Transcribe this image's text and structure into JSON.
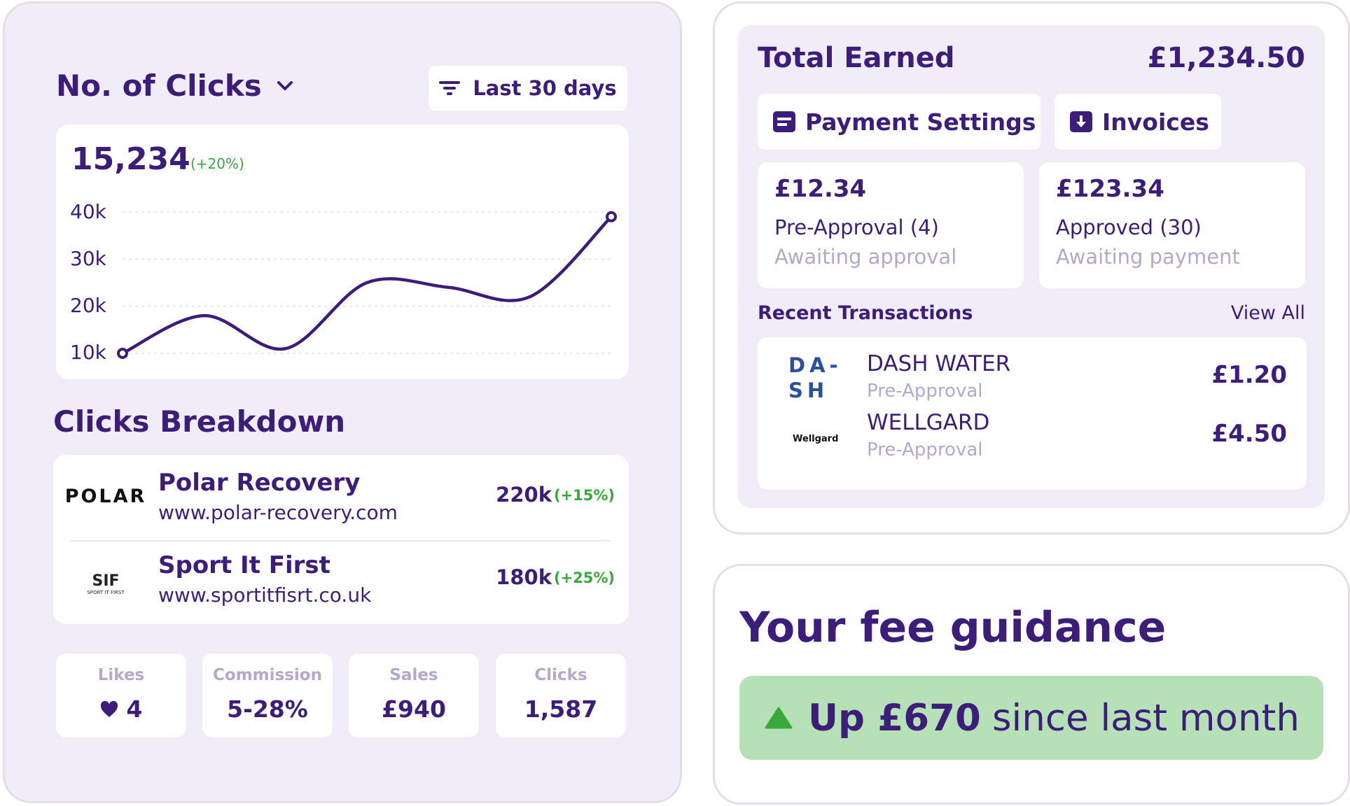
{
  "clicks_panel": {
    "title": "No. of Clicks",
    "filter_label": "Last 30 days",
    "total": "15,234",
    "change": "(+20%)",
    "colors": {
      "line": "#3d1d7a",
      "positive": "#3aa83c"
    }
  },
  "chart_data": {
    "type": "line",
    "title": "",
    "xlabel": "",
    "ylabel": "",
    "yticks": [
      "40k",
      "30k",
      "20k",
      "10k"
    ],
    "ylim": [
      10000,
      40000
    ],
    "grid": true,
    "series": [
      {
        "values": [
          10000,
          18000,
          11000,
          25000,
          24000,
          22000,
          39000
        ]
      }
    ]
  },
  "breakdown": {
    "title": "Clicks Breakdown",
    "items": [
      {
        "logo_text": "POLAR",
        "name": "Polar Recovery",
        "url": "www.polar-recovery.com",
        "value": "220k",
        "change": "(+15%)"
      },
      {
        "logo_text": "SIF",
        "logo_sub": "SPORT IT FIRST",
        "name": "Sport It First",
        "url": "www.sportitfisrt.co.uk",
        "value": "180k",
        "change": "(+25%)"
      }
    ]
  },
  "stats": [
    {
      "label": "Likes",
      "value": "4",
      "icon": "heart-icon"
    },
    {
      "label": "Commission",
      "value": "5-28%"
    },
    {
      "label": "Sales",
      "value": "£940"
    },
    {
      "label": "Clicks",
      "value": "1,587"
    }
  ],
  "earnings": {
    "title": "Total Earned",
    "amount": "£1,234.50",
    "payment_settings_label": "Payment Settings",
    "invoices_label": "Invoices",
    "pre_approval": {
      "amount": "£12.34",
      "label": "Pre-Approval (4)",
      "status": "Awaiting approval"
    },
    "approved": {
      "amount": "£123.34",
      "label": "Approved (30)",
      "status": "Awaiting payment"
    },
    "recent_title": "Recent Transactions",
    "view_all_label": "View All",
    "transactions": [
      {
        "logo_text_1": "DA-",
        "logo_text_2": "SH",
        "name": "DASH WATER",
        "status": "Pre-Approval",
        "amount": "£1.20"
      },
      {
        "logo_text_1": "Wellgard",
        "name": "WELLGARD",
        "status": "Pre-Approval",
        "amount": "£4.50"
      }
    ]
  },
  "fee_guidance": {
    "title": "Your fee guidance",
    "highlight": "Up £670",
    "rest": "since last month",
    "colors": {
      "banner": "#b6e1b7",
      "arrow": "#3aa83c"
    }
  }
}
